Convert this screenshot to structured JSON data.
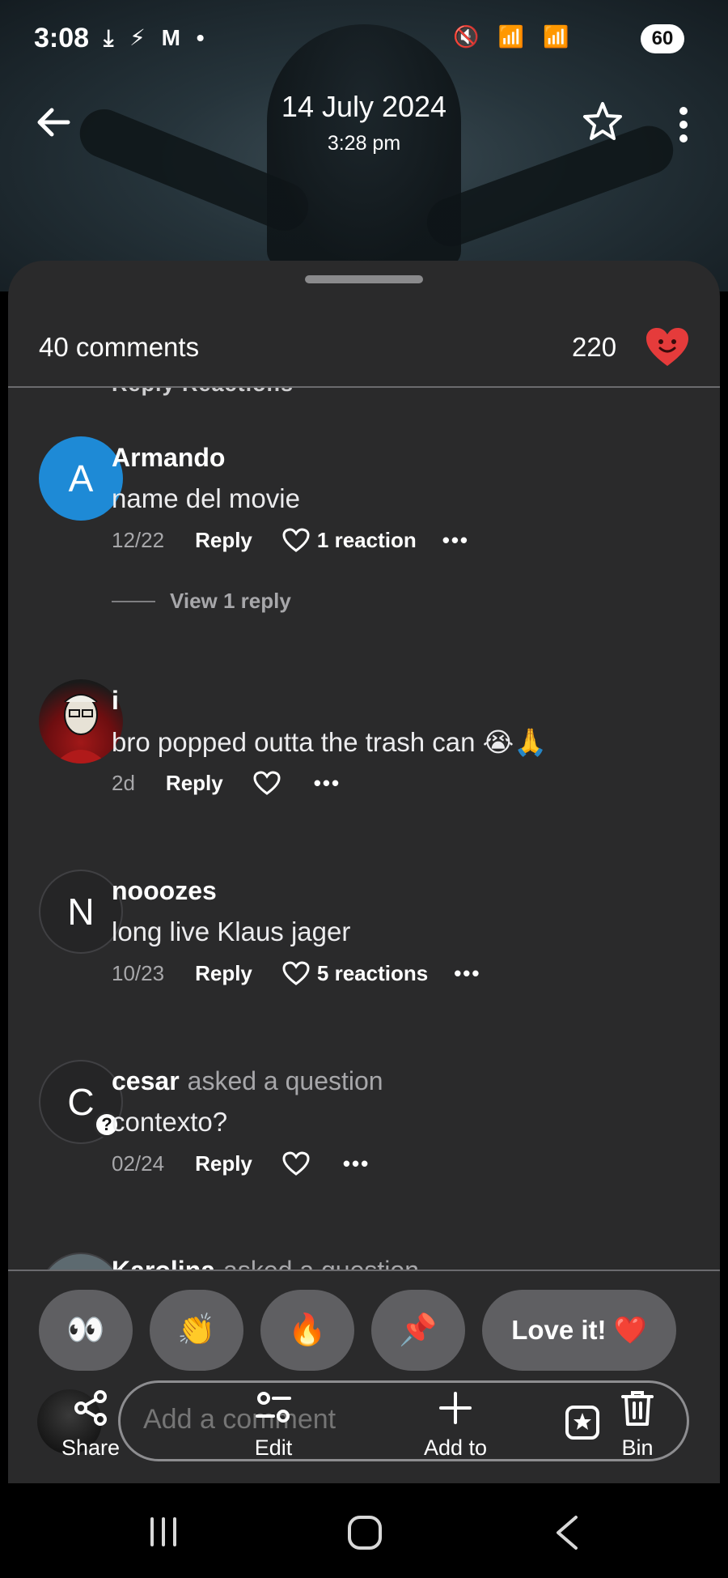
{
  "status_bar": {
    "time": "3:08",
    "left_icons": "⤓ ⚡ M •",
    "right_icons": "🔇 📶 📶",
    "battery": "60"
  },
  "header": {
    "title": "14 July 2024",
    "subtitle": "3:28 pm"
  },
  "sheet": {
    "comments_label": "40 comments",
    "likes_count": "220"
  },
  "partial_top_text": "Reply  Reactions",
  "comments": [
    {
      "avatar_letter": "A",
      "name": "Armando",
      "suffix": "",
      "text": "name del movie",
      "date": "12/22",
      "reply": "Reply",
      "reaction": "1 reaction",
      "view_replies": "View 1 reply"
    },
    {
      "avatar_letter": "",
      "name": "i",
      "suffix": "",
      "text": "bro popped outta the trash can 😭🙏",
      "date": "2d",
      "reply": "Reply",
      "reaction": ""
    },
    {
      "avatar_letter": "N",
      "name": "nooozes",
      "suffix": "",
      "text": "long live Klaus jager",
      "date": "10/23",
      "reply": "Reply",
      "reaction": "5 reactions"
    },
    {
      "avatar_letter": "C",
      "name": "cesar",
      "suffix": "asked a question",
      "text": "contexto?",
      "date": "02/24",
      "reply": "Reply",
      "reaction": ""
    },
    {
      "avatar_letter": "",
      "name": "Karolina",
      "suffix": "asked a question",
      "text": "",
      "date": "",
      "reply": "",
      "reaction": ""
    }
  ],
  "quick_reactions": [
    "👀",
    "👏",
    "🔥",
    "📌"
  ],
  "love_it": "Love it! ❤️",
  "composer": {
    "placeholder": "Add a comment"
  },
  "actions": {
    "share": "Share",
    "edit": "Edit",
    "add_to": "Add to",
    "bin": "Bin"
  },
  "colors": {
    "sheet_bg": "#2a2a2b",
    "accent_blue": "#1e8ad6",
    "heart_red": "#e53b3b"
  }
}
